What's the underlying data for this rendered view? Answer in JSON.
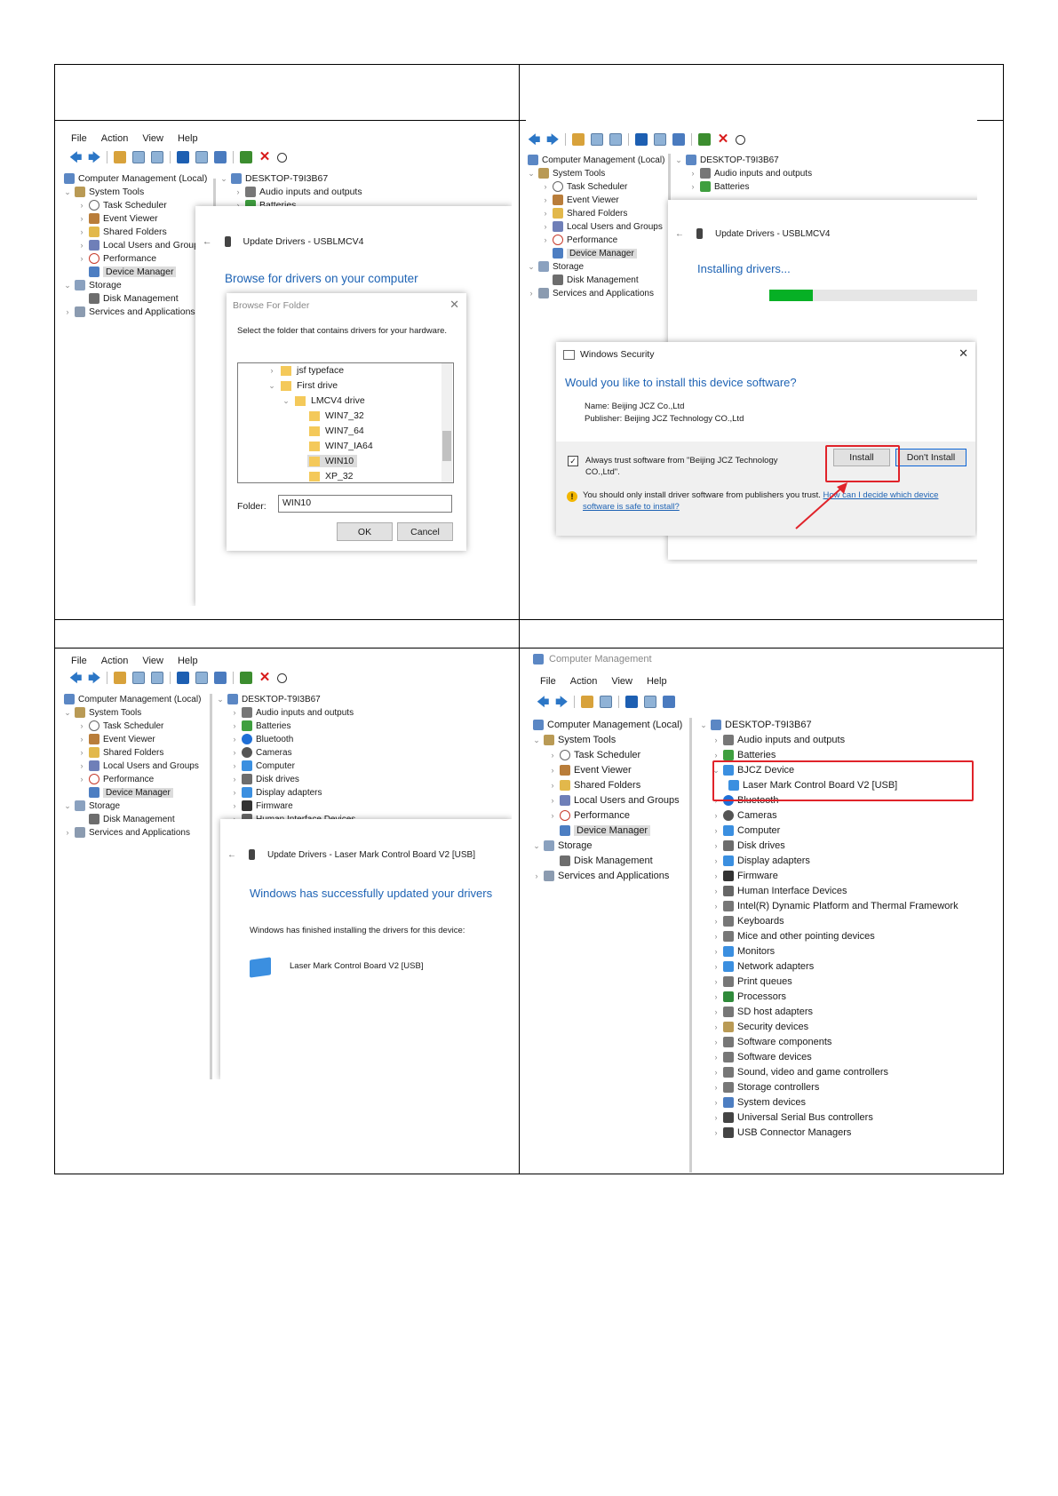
{
  "menu": {
    "file": "File",
    "action": "Action",
    "view": "View",
    "help": "Help"
  },
  "tree": {
    "root": "Computer Management (Local)",
    "system_tools": "System Tools",
    "task_scheduler": "Task Scheduler",
    "event_viewer": "Event Viewer",
    "shared_folders": "Shared Folders",
    "local_users": "Local Users and Groups",
    "performance": "Performance",
    "device_manager": "Device Manager",
    "storage": "Storage",
    "disk_management": "Disk Management",
    "services": "Services and Applications"
  },
  "devices": {
    "host": "DESKTOP-T9I3B67",
    "audio": "Audio inputs and outputs",
    "batteries": "Batteries",
    "bluetooth": "Bluetooth",
    "cameras": "Cameras",
    "computer": "Computer",
    "disk_drives": "Disk drives",
    "display": "Display adapters",
    "firmware": "Firmware",
    "hid": "Human Interface Devices",
    "intel": "Intel(R) Dynamic Platform and Thermal Framework",
    "keyboards": "Keyboards",
    "mice": "Mice and other pointing devices",
    "monitors": "Monitors",
    "network": "Network adapters",
    "print": "Print queues",
    "processors": "Processors",
    "sd": "SD host adapters",
    "security": "Security devices",
    "sw_components": "Software components",
    "sw_devices": "Software devices",
    "sound": "Sound, video and game controllers",
    "storage_ctrl": "Storage controllers",
    "system_devices": "System devices",
    "usb": "Universal Serial Bus controllers",
    "usb_conn": "USB Connector Managers",
    "bjcz": "BJCZ Device",
    "laser": "Laser Mark Control Board V2 [USB]"
  },
  "step1": {
    "header": "Update Drivers - USBLMCV4",
    "heading": "Browse for drivers on your computer",
    "dialog_title": "Browse For Folder",
    "instruction": "Select the folder that contains drivers for your hardware.",
    "folders": [
      "jsf typeface",
      "First drive",
      "LMCV4 drive",
      "WIN7_32",
      "WIN7_64",
      "WIN7_IA64",
      "WIN10",
      "XP_32"
    ],
    "folder_label": "Folder:",
    "folder_value": "WIN10",
    "ok": "OK",
    "cancel": "Cancel"
  },
  "step2": {
    "header": "Update Drivers - USBLMCV4",
    "status": "Installing drivers...",
    "progress": 0.2,
    "security_title": "Windows Security",
    "question": "Would you like to install this device software?",
    "name": "Name: Beijing JCZ Co.,Ltd",
    "publisher": "Publisher: Beijing JCZ Technology CO.,Ltd",
    "always_trust": "Always trust software from \"Beijing JCZ Technology CO.,Ltd\".",
    "install": "Install",
    "dont_install": "Don't Install",
    "warning": "You should only install driver software from publishers you trust.",
    "warning_link": "How can I decide which device software is safe to install?"
  },
  "step3": {
    "header": "Update Drivers - Laser Mark Control Board V2 [USB]",
    "heading": "Windows has successfully updated your drivers",
    "body": "Windows has finished installing the drivers for this device:",
    "device": "Laser Mark Control Board V2 [USB]"
  },
  "step4": {
    "window_title": "Computer Management"
  },
  "colors": {
    "accent": "#1e63b4",
    "highlight": "#e0232a",
    "progress": "#06b025"
  }
}
